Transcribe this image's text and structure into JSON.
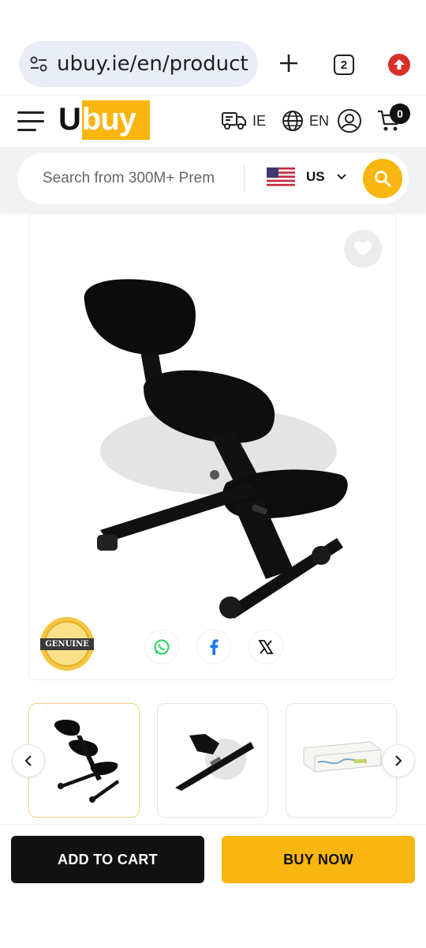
{
  "browser": {
    "url": "ubuy.ie/en/product",
    "tab_count": "2",
    "icons": [
      "tune-icon",
      "plus-icon",
      "tabs-icon",
      "update-icon"
    ]
  },
  "header": {
    "logo_u": "U",
    "logo_buy": "buy",
    "shipping_country": "IE",
    "language": "EN",
    "cart_count": "0",
    "brand_color": "#f9b611"
  },
  "search": {
    "placeholder": "Search from 300M+ Prem",
    "store_country": "US"
  },
  "product": {
    "badge_text": "GENUINE",
    "share_icons": [
      "whatsapp-icon",
      "facebook-icon",
      "x-icon"
    ]
  },
  "actions": {
    "add_to_cart": "ADD TO CART",
    "buy_now": "BUY NOW"
  }
}
